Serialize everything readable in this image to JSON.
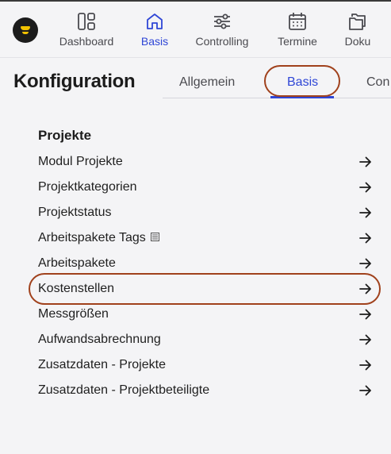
{
  "nav": {
    "items": [
      {
        "label": "Dashboard",
        "icon": "dashboard-icon",
        "active": false
      },
      {
        "label": "Basis",
        "icon": "home-icon",
        "active": true
      },
      {
        "label": "Controlling",
        "icon": "sliders-icon",
        "active": false
      },
      {
        "label": "Termine",
        "icon": "calendar-icon",
        "active": false
      },
      {
        "label": "Doku",
        "icon": "folder-icon",
        "active": false
      }
    ]
  },
  "header": {
    "title": "Konfiguration",
    "tabs": [
      {
        "label": "Allgemein",
        "active": false
      },
      {
        "label": "Basis",
        "active": true
      },
      {
        "label": "Con",
        "active": false
      }
    ]
  },
  "section": {
    "title": "Projekte",
    "items": [
      {
        "label": "Modul Projekte"
      },
      {
        "label": "Projektkategorien"
      },
      {
        "label": "Projektstatus"
      },
      {
        "label": "Arbeitspakete Tags",
        "icon": "list-icon"
      },
      {
        "label": "Arbeitspakete"
      },
      {
        "label": "Kostenstellen",
        "highlighted": true
      },
      {
        "label": "Messgrößen"
      },
      {
        "label": "Aufwandsabrechnung"
      },
      {
        "label": "Zusatzdaten - Projekte"
      },
      {
        "label": "Zusatzdaten - Projektbeteiligte"
      }
    ]
  },
  "colors": {
    "accent": "#2f46d6",
    "highlight": "#a0411c"
  }
}
